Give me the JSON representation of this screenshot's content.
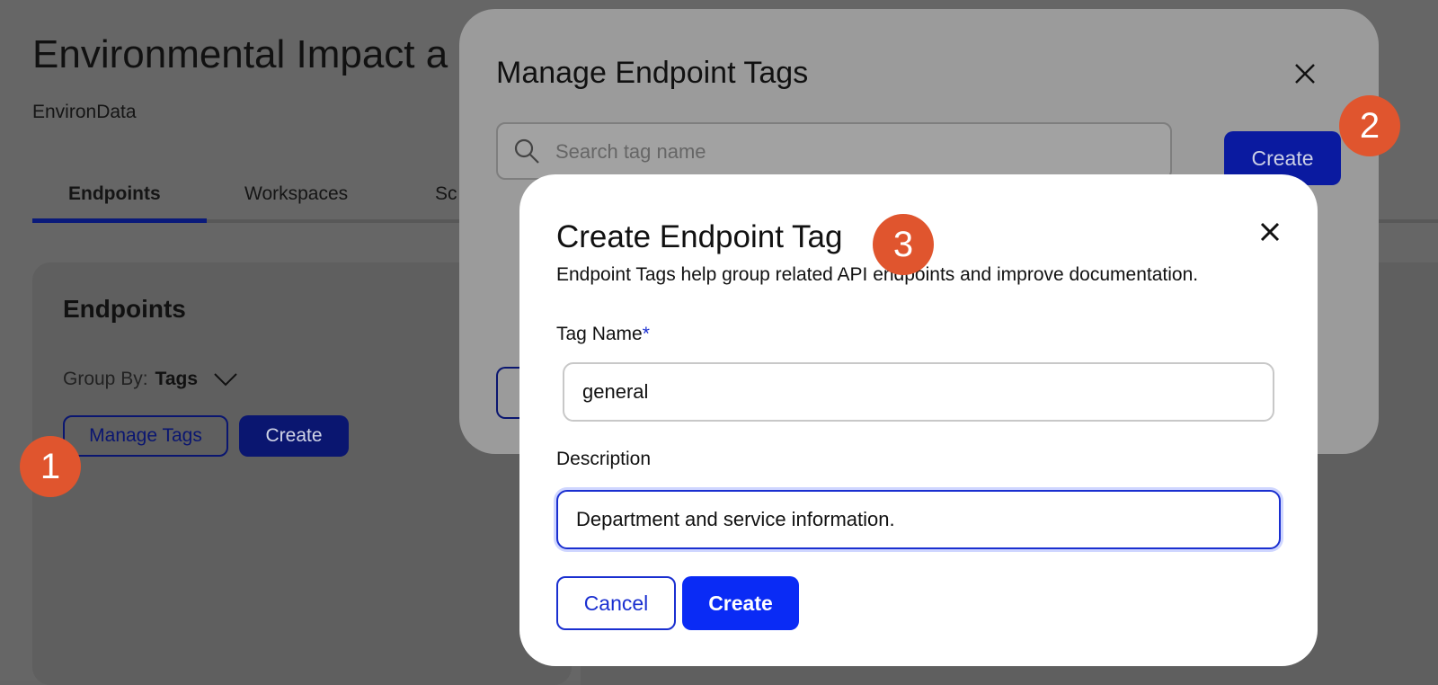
{
  "page": {
    "title": "Environmental Impact a",
    "subtitle": "EnvironData",
    "tabs": [
      {
        "label": "Endpoints",
        "active": true
      },
      {
        "label": "Workspaces",
        "active": false
      },
      {
        "label": "Sc",
        "active": false
      }
    ]
  },
  "panel": {
    "title": "Endpoints",
    "group_by_label": "Group By:",
    "group_by_value": "Tags",
    "manage_tags_label": "Manage Tags",
    "create_label": "Create"
  },
  "manage_dialog": {
    "title": "Manage Endpoint Tags",
    "search_placeholder": "Search tag name",
    "create_label": "Create"
  },
  "create_dialog": {
    "title": "Create Endpoint Tag",
    "description": "Endpoint Tags help group related API endpoints and improve documentation.",
    "tag_name_label": "Tag Name",
    "required_mark": "*",
    "tag_name_value": "general",
    "description_label": "Description",
    "description_value": "Department and service information.",
    "cancel_label": "Cancel",
    "create_label": "Create"
  },
  "badges": [
    "1",
    "2",
    "3"
  ],
  "colors": {
    "accent": "#0a2bf5",
    "badge": "#e0552e",
    "dark_navy": "#0a1670"
  }
}
